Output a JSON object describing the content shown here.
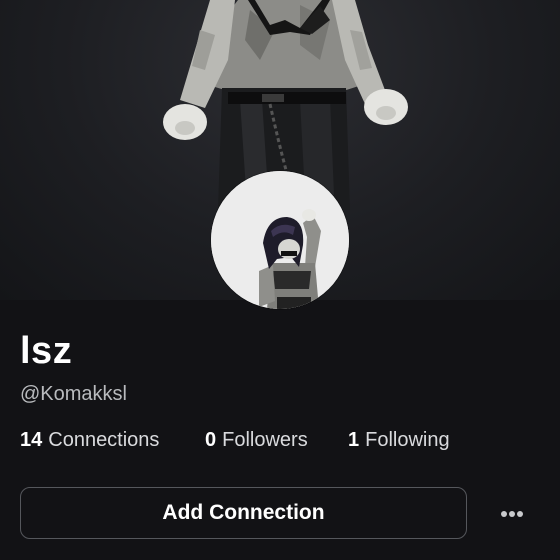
{
  "profile": {
    "display_name": "lsz",
    "username": "@Komakksl"
  },
  "stats": {
    "connections": {
      "count": "14",
      "label": "Connections"
    },
    "followers": {
      "count": "0",
      "label": "Followers"
    },
    "following": {
      "count": "1",
      "label": "Following"
    }
  },
  "actions": {
    "add_connection_label": "Add Connection",
    "more_icon": "more-horizontal-icon"
  },
  "colors": {
    "background": "#121215",
    "banner": "#1d1e22",
    "muted_text": "#b9bbbe",
    "button_border": "#55575c"
  }
}
